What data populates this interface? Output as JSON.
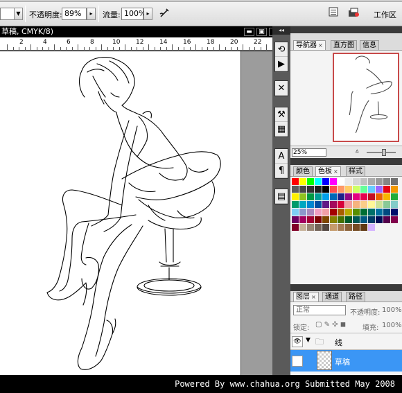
{
  "options": {
    "opacity_label": "不透明度:",
    "opacity_value": "89%",
    "flow_label": "流量:",
    "flow_value": "100%",
    "workspace_label": "工作区"
  },
  "document": {
    "title": "草稿, CMYK/8)",
    "ruler_ticks": [
      "2",
      "4",
      "6",
      "8",
      "10",
      "12",
      "14",
      "16",
      "18",
      "20",
      "22"
    ]
  },
  "navigator": {
    "tabs": [
      "导航器",
      "直方图",
      "信息"
    ],
    "zoom": "25%"
  },
  "swatches_panel": {
    "tabs": [
      "颜色",
      "色板",
      "样式"
    ],
    "colors": [
      "#ff0000",
      "#ffff00",
      "#00ff00",
      "#00ffff",
      "#0000ff",
      "#ff00ff",
      "#ffffff",
      "#ebebeb",
      "#d6d6d6",
      "#c2c2c2",
      "#adadad",
      "#999999",
      "#858585",
      "#707070",
      "#5c5c5c",
      "#474747",
      "#333333",
      "#1f1f1f",
      "#000000",
      "#ff4d4d",
      "#ff9966",
      "#ffcc66",
      "#ccff66",
      "#66ff99",
      "#66ccff",
      "#9966ff",
      "#e60012",
      "#f39800",
      "#fff100",
      "#8fc31f",
      "#009944",
      "#009e96",
      "#00a0e9",
      "#0068b7",
      "#1d2088",
      "#920783",
      "#e4007f",
      "#e5004f",
      "#c30d23",
      "#eb6100",
      "#f8b500",
      "#22ac38",
      "#009b6b",
      "#00a7c1",
      "#0086d1",
      "#004ea2",
      "#601986",
      "#a40b5d",
      "#d7003a",
      "#f29c9f",
      "#f6b37f",
      "#facd89",
      "#fff799",
      "#cce198",
      "#89c997",
      "#84ccc9",
      "#7ecef4",
      "#8c97cb",
      "#aa89bd",
      "#f19ec2",
      "#f19fa8",
      "#a40000",
      "#a85d00",
      "#b7aa00",
      "#588e00",
      "#006e33",
      "#007068",
      "#006f9f",
      "#004a80",
      "#000f6b",
      "#6c0061",
      "#a2005f",
      "#a20034",
      "#7d0000",
      "#7e4500",
      "#878000",
      "#437000",
      "#005a28",
      "#005854",
      "#005a82",
      "#003b66",
      "#000b54",
      "#54004c",
      "#80004b",
      "#800028",
      "#c7b299",
      "#998675",
      "#736357",
      "#534741",
      "#c69c6d",
      "#a67c52",
      "#8c6239",
      "#754c24",
      "#603913",
      "#d4b3ff"
    ]
  },
  "layers_panel": {
    "tabs": [
      "图层",
      "通道",
      "路径"
    ],
    "blend_mode": "正常",
    "opacity_label": "不透明度:",
    "opacity_value": "100%",
    "lock_label": "锁定:",
    "fill_label": "填充:",
    "fill_value": "100%",
    "layers": [
      {
        "name": "线",
        "type": "group"
      },
      {
        "name": "草稿",
        "type": "layer",
        "selected": true
      }
    ]
  },
  "footer": {
    "credit": "Powered By www.chahua.org  Submitted May 2008"
  },
  "colors": {
    "selection": "#3b96f5",
    "nav_frame": "#c84a4a"
  }
}
